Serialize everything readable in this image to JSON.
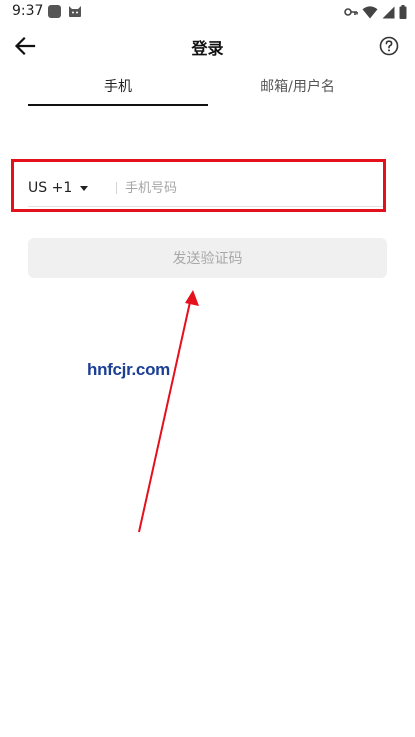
{
  "status_bar": {
    "time": "9:37",
    "left_icons": [
      "app-square-icon",
      "cat-icon"
    ],
    "right_icons": [
      "key-icon",
      "wifi-icon",
      "signal-icon",
      "battery-icon"
    ]
  },
  "header": {
    "title": "登录",
    "back_icon": "arrow-left-icon",
    "help_icon": "question-circle-icon"
  },
  "tabs": [
    {
      "label": "手机",
      "active": true
    },
    {
      "label": "邮箱/用户名",
      "active": false
    }
  ],
  "phone_form": {
    "country_code": "US +1",
    "phone_placeholder": "手机号码",
    "phone_value": ""
  },
  "send_button": {
    "label": "发送验证码",
    "enabled": false
  },
  "annotations": {
    "highlight_color": "#e4101b",
    "arrow_color": "#e4101b"
  },
  "watermark": {
    "text": "hnfcjr.com",
    "color": "#1c3f95"
  },
  "colors": {
    "tab_underline": "#111111",
    "button_bg": "#f0f0f0",
    "button_text": "#a8a8a8",
    "placeholder": "#a6a6a6"
  }
}
